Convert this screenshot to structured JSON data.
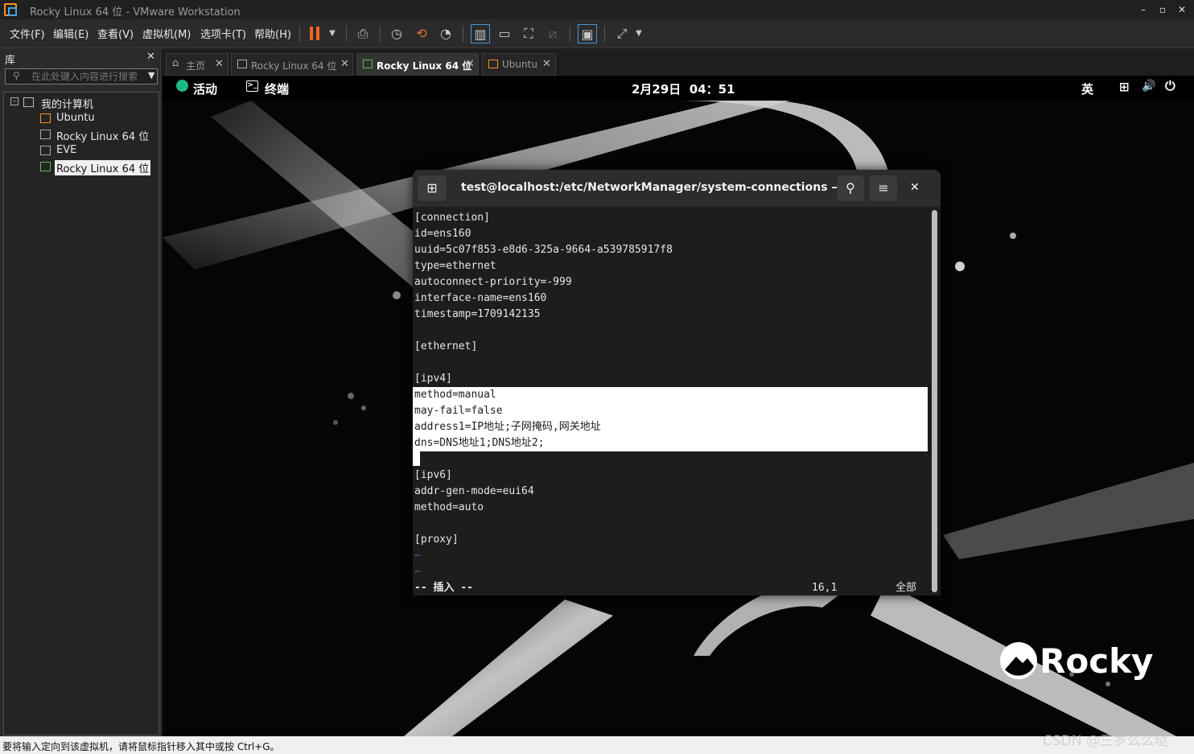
{
  "window": {
    "title": "Rocky Linux 64 位 - VMware Workstation",
    "min": "–",
    "max": "▫",
    "close": "✕"
  },
  "menu": [
    "文件(F)",
    "编辑(E)",
    "查看(V)",
    "虚拟机(M)",
    "选项卡(T)",
    "帮助(H)"
  ],
  "library": {
    "header": "库",
    "close": "✕",
    "search_placeholder": "在此处键入内容进行搜索",
    "root": "我的计算机",
    "items": [
      "Ubuntu",
      "Rocky Linux 64 位",
      "EVE",
      "Rocky Linux 64 位"
    ]
  },
  "tabs": [
    {
      "label": "主页"
    },
    {
      "label": "Rocky Linux 64 位"
    },
    {
      "label": "Rocky Linux 64 位"
    },
    {
      "label": "Ubuntu"
    }
  ],
  "gnome": {
    "activities": "活动",
    "app": "终端",
    "clock": "2月29日  04：51",
    "input": "英"
  },
  "terminal": {
    "title": "test@localhost:/etc/NetworkManager/system-connections — /…",
    "lines": [
      "[connection]",
      "id=ens160",
      "uuid=5c07f853-e8d6-325a-9664-a539785917f8",
      "type=ethernet",
      "autoconnect-priority=-999",
      "interface-name=ens160",
      "timestamp=1709142135",
      "",
      "[ethernet]",
      "",
      "[ipv4]",
      "method=manual",
      "may-fail=false",
      "address1=IP地址;子网掩码,网关地址",
      "dns=DNS地址1;DNS地址2;",
      "",
      "[ipv6]",
      "addr-gen-mode=eui64",
      "method=auto",
      "",
      "[proxy]",
      "~",
      "~"
    ],
    "mode": "-- 插入 --",
    "position": "16,1",
    "scroll": "全部"
  },
  "brand": "Rocky",
  "statusbar": "要将输入定向到该虚拟机，请将鼠标指针移入其中或按 Ctrl+G。",
  "watermark": "CSDN @三岁么么哒"
}
